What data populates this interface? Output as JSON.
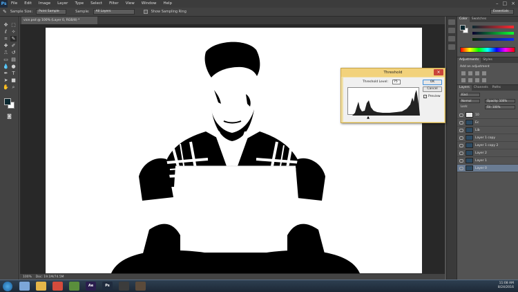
{
  "app": {
    "logo": "Ps"
  },
  "menu": [
    "File",
    "Edit",
    "Image",
    "Layer",
    "Type",
    "Select",
    "Filter",
    "View",
    "Window",
    "Help"
  ],
  "options_bar": {
    "sample_size_label": "Sample Size:",
    "sample_size_value": "Point Sample",
    "sample_label": "Sample:",
    "sample_value": "All Layers",
    "show_ring_label": "Show Sampling Ring",
    "workspace": "Essentials"
  },
  "document": {
    "tab_title": "vice.psd @ 100% (Layer 0, RGB/8) *"
  },
  "status_bar": {
    "zoom": "100%",
    "doc_info": "Doc: 19.1M/74.5M"
  },
  "colors": {
    "foreground": "#0b2830",
    "background": "#ffffff"
  },
  "panels": {
    "color_tabs": [
      "Color",
      "Swatches"
    ],
    "adjust_tabs": [
      "Adjustments",
      "Styles"
    ],
    "adjust_label": "Add an adjustment",
    "layers_tabs": [
      "Layers",
      "Channels",
      "Paths"
    ],
    "kind_filter": "Kind",
    "blend_mode": "Normal",
    "opacity": "Opacity: 100%",
    "lock_label": "Lock:",
    "fill": "Fill: 100%",
    "layers": [
      {
        "name": "10",
        "thumb": "white",
        "selected": false
      },
      {
        "name": "Ec",
        "thumb": "blue",
        "selected": false
      },
      {
        "name": "Lib",
        "thumb": "blue",
        "selected": false
      },
      {
        "name": "Layer 1 copy",
        "thumb": "blue",
        "selected": false
      },
      {
        "name": "Layer 1 copy 2",
        "thumb": "blue",
        "selected": false
      },
      {
        "name": "Layer 2",
        "thumb": "blue",
        "selected": false
      },
      {
        "name": "Layer 1",
        "thumb": "blue",
        "selected": false
      },
      {
        "name": "Layer 0",
        "thumb": "blue",
        "selected": true
      }
    ]
  },
  "threshold_dialog": {
    "title": "Threshold",
    "close_glyph": "×",
    "level_label": "Threshold Level:",
    "level_value": "75",
    "ok_label": "OK",
    "cancel_label": "Cancel",
    "preview_label": "Preview",
    "preview_checked": true,
    "histogram_level_fraction": 0.29
  },
  "taskbar": {
    "apps": [
      {
        "name": "file-icon",
        "label": "",
        "color": "#7ca6d8"
      },
      {
        "name": "folder-icon",
        "label": "",
        "color": "#e4b649"
      },
      {
        "name": "chrome-icon",
        "label": "",
        "color": "#d44b3c"
      },
      {
        "name": "media-icon",
        "label": "",
        "color": "#5a8e3c"
      },
      {
        "name": "after-effects-icon",
        "label": "Ae",
        "color": "#2a1d4e"
      },
      {
        "name": "photoshop-icon",
        "label": "Ps",
        "color": "#1f2b3d"
      },
      {
        "name": "eye-app-icon",
        "label": "",
        "color": "#3c3c3c"
      },
      {
        "name": "misc-app-icon",
        "label": "",
        "color": "#5b4a3a"
      }
    ],
    "time": "11:08 AM",
    "date": "8/24/2016"
  }
}
